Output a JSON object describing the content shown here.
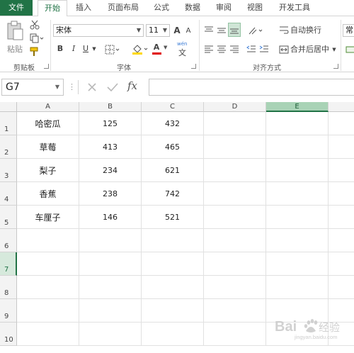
{
  "ribbon": {
    "tabs": [
      "文件",
      "开始",
      "插入",
      "页面布局",
      "公式",
      "数据",
      "审阅",
      "视图",
      "开发工具"
    ],
    "clipboard": {
      "paste_label": "粘贴",
      "group_label": "剪贴板"
    },
    "font": {
      "name": "宋体",
      "size": "11",
      "group_label": "字体",
      "bold": "B",
      "italic": "I",
      "underline": "U",
      "grow": "A",
      "shrink": "A",
      "fill_letter": "A",
      "wen": "wén",
      "wen_char": "文"
    },
    "alignment": {
      "wrap_text": "自动换行",
      "merge_center": "合并后居中",
      "group_label": "对齐方式"
    },
    "number": {
      "format": "常"
    },
    "accent_color": "#217346"
  },
  "formula_bar": {
    "name_box": "G7",
    "fx": "fx",
    "value": ""
  },
  "sheet": {
    "columns": [
      "A",
      "B",
      "C",
      "D",
      "E"
    ],
    "selected_column": "E",
    "rows": [
      "1",
      "2",
      "3",
      "4",
      "5",
      "6",
      "7",
      "8",
      "9",
      "10"
    ],
    "selected_row": "7",
    "data": [
      [
        "哈密瓜",
        "125",
        "432"
      ],
      [
        "草莓",
        "413",
        "465"
      ],
      [
        "梨子",
        "234",
        "621"
      ],
      [
        "香蕉",
        "238",
        "742"
      ],
      [
        "车厘子",
        "146",
        "521"
      ]
    ]
  },
  "watermark": {
    "text": "Bai",
    "brand": "经验",
    "url": "jingyan.baidu.com"
  }
}
